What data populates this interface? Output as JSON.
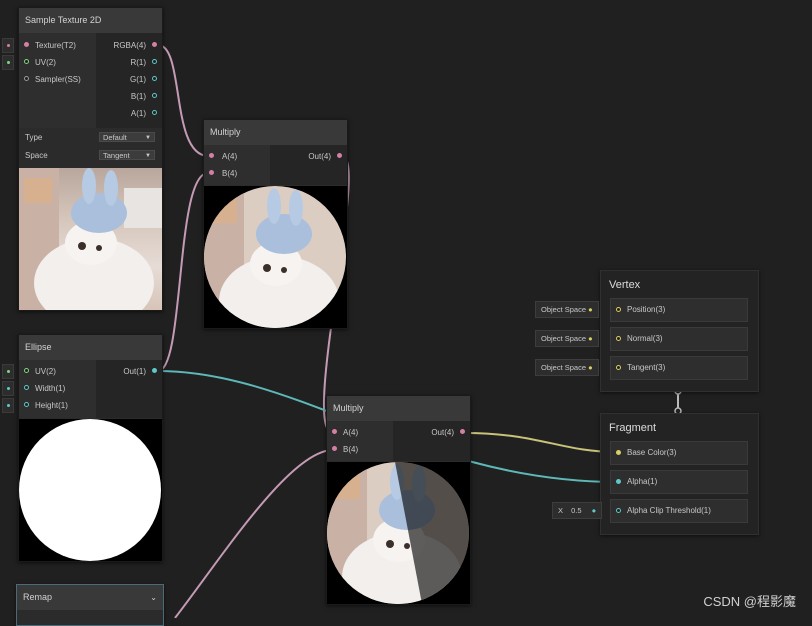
{
  "nodes": {
    "sample_texture": {
      "title": "Sample Texture 2D",
      "inputs": [
        "Texture(T2)",
        "UV(2)",
        "Sampler(SS)"
      ],
      "outputs": [
        "RGBA(4)",
        "R(1)",
        "G(1)",
        "B(1)",
        "A(1)"
      ],
      "type_label": "Type",
      "type_value": "Default",
      "space_label": "Space",
      "space_value": "Tangent"
    },
    "multiply1": {
      "title": "Multiply",
      "inputs": [
        "A(4)",
        "B(4)"
      ],
      "outputs": [
        "Out(4)"
      ]
    },
    "ellipse": {
      "title": "Ellipse",
      "inputs": [
        "UV(2)",
        "Width(1)",
        "Height(1)"
      ],
      "outputs": [
        "Out(1)"
      ]
    },
    "multiply2": {
      "title": "Multiply",
      "inputs": [
        "A(4)",
        "B(4)"
      ],
      "outputs": [
        "Out(4)"
      ]
    },
    "remap": {
      "title": "Remap"
    }
  },
  "vertex": {
    "title": "Vertex",
    "slots": [
      {
        "chip": "Object Space",
        "label": "Position(3)"
      },
      {
        "chip": "Object Space",
        "label": "Normal(3)"
      },
      {
        "chip": "Object Space",
        "label": "Tangent(3)"
      }
    ]
  },
  "fragment": {
    "title": "Fragment",
    "slots": [
      {
        "label": "Base Color(3)"
      },
      {
        "label": "Alpha(1)"
      },
      {
        "label": "Alpha Clip Threshold(1)"
      }
    ],
    "threshold_axis": "X",
    "threshold_value": "0.5"
  },
  "watermark": "CSDN @程影魔",
  "colors": {
    "wire_pink": "#c49ab5",
    "wire_cyan": "#5fb8b8",
    "wire_yellow": "#c8c27a",
    "node_header": "#393939",
    "background": "#202020"
  },
  "icons": [
    "chevron-down-icon",
    "port-dot-icon"
  ]
}
